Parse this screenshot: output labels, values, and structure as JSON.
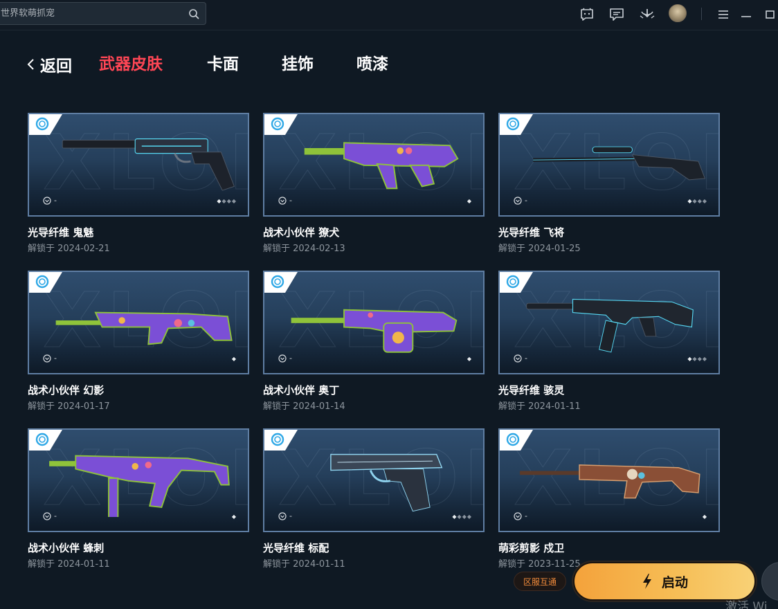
{
  "titlebar": {
    "search_placeholder": "世界软萌抓宠",
    "icons": [
      "search-icon",
      "chat-bubble-icon",
      "message-icon",
      "download-icon",
      "avatar",
      "menu-icon",
      "minimize-icon",
      "maximize-icon"
    ]
  },
  "nav": {
    "back_label": "返回",
    "tabs": [
      {
        "label": "武器皮肤",
        "active": true
      },
      {
        "label": "卡面",
        "active": false
      },
      {
        "label": "挂饰",
        "active": false
      },
      {
        "label": "喷漆",
        "active": false
      }
    ]
  },
  "cards": [
    {
      "name": "光导纤维 鬼魅",
      "unlock": "解锁于 2024-02-21",
      "level": "-",
      "tier_filled": 1,
      "tier_total": 4,
      "weapon": "pistol-silenced"
    },
    {
      "name": "战术小伙伴 獠犬",
      "unlock": "解锁于 2024-02-13",
      "level": "-",
      "tier_filled": 1,
      "tier_total": 1,
      "weapon": "bullpup-rifle"
    },
    {
      "name": "光导纤维 飞将",
      "unlock": "解锁于 2024-01-25",
      "level": "-",
      "tier_filled": 1,
      "tier_total": 4,
      "weapon": "sniper-rifle"
    },
    {
      "name": "战术小伙伴 幻影",
      "unlock": "解锁于 2024-01-17",
      "level": "-",
      "tier_filled": 1,
      "tier_total": 1,
      "weapon": "assault-rifle"
    },
    {
      "name": "战术小伙伴 奥丁",
      "unlock": "解锁于 2024-01-14",
      "level": "-",
      "tier_filled": 1,
      "tier_total": 1,
      "weapon": "heavy-machine-gun"
    },
    {
      "name": "光导纤维 骇灵",
      "unlock": "解锁于 2024-01-11",
      "level": "-",
      "tier_filled": 1,
      "tier_total": 4,
      "weapon": "smg"
    },
    {
      "name": "战术小伙伴 蜂刺",
      "unlock": "解锁于 2024-01-11",
      "level": "-",
      "tier_filled": 1,
      "tier_total": 1,
      "weapon": "compact-smg"
    },
    {
      "name": "光导纤维 标配",
      "unlock": "解锁于 2024-01-11",
      "level": "-",
      "tier_filled": 1,
      "tier_total": 4,
      "weapon": "pistol"
    },
    {
      "name": "萌彩剪影 戍卫",
      "unlock": "解锁于 2023-11-25",
      "level": "-",
      "tier_filled": 1,
      "tier_total": 1,
      "weapon": "marksman-rifle"
    }
  ],
  "actions": {
    "region_label": "区服互通",
    "launch_label": "启动"
  },
  "os_watermark": "激活 Wi",
  "colors": {
    "background": "#0f1923",
    "accent_red": "#ff4655",
    "launch_orange": "#f6b04a",
    "card_border": "#5f7ea3",
    "region_text": "#f08a3a"
  }
}
